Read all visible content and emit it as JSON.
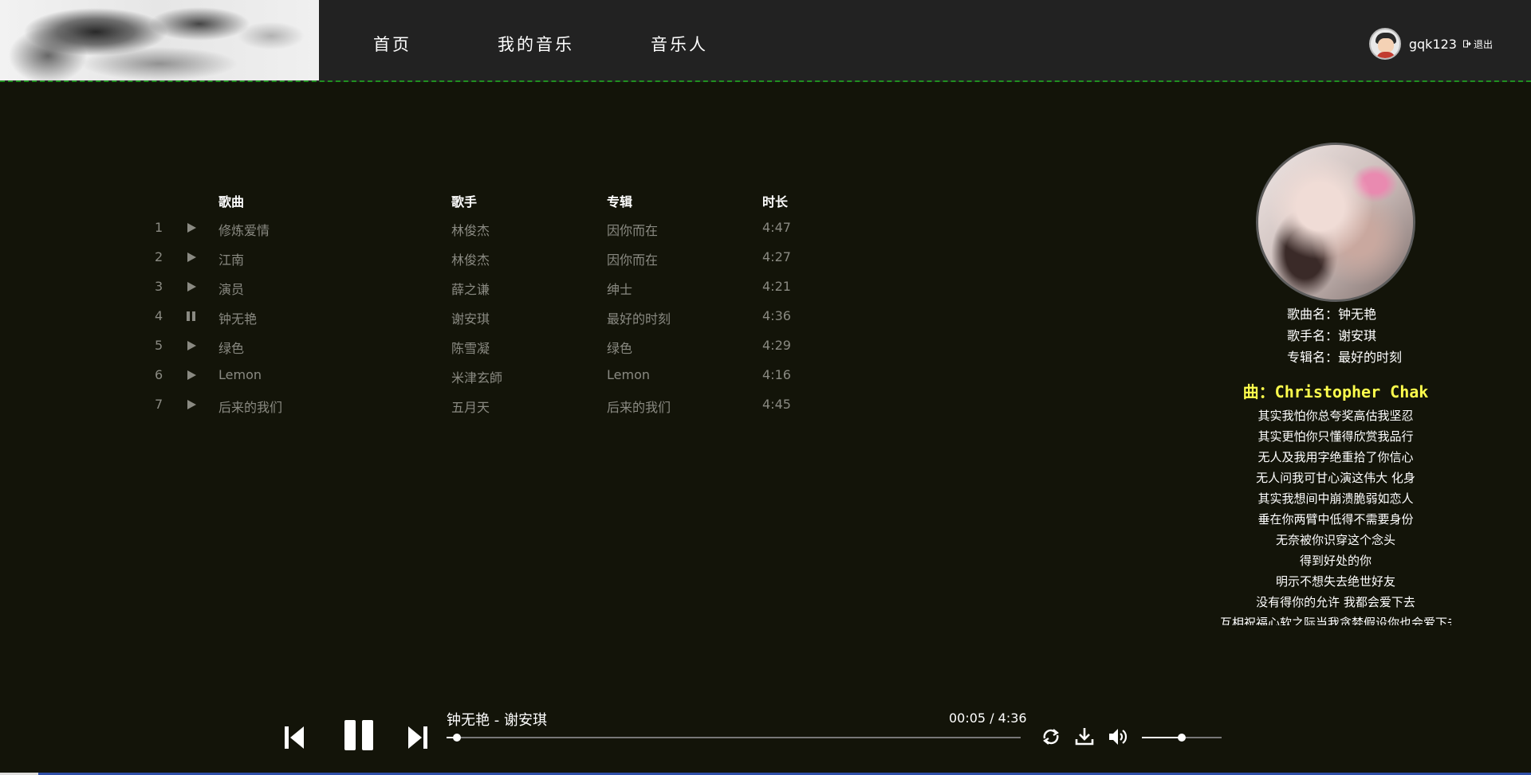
{
  "nav": {
    "items": [
      {
        "label": "首页"
      },
      {
        "label": "我的音乐"
      },
      {
        "label": "音乐人"
      }
    ]
  },
  "user": {
    "name": "gqk123",
    "logout_label": "退出"
  },
  "table": {
    "headers": {
      "song": "歌曲",
      "artist": "歌手",
      "album": "专辑",
      "duration": "时长"
    },
    "rows": [
      {
        "num": "1",
        "title": "修炼爱情",
        "artist": "林俊杰",
        "album": "因你而在",
        "duration": "4:47",
        "state": "play"
      },
      {
        "num": "2",
        "title": "江南",
        "artist": "林俊杰",
        "album": "因你而在",
        "duration": "4:27",
        "state": "play"
      },
      {
        "num": "3",
        "title": "演员",
        "artist": "薛之谦",
        "album": "绅士",
        "duration": "4:21",
        "state": "play"
      },
      {
        "num": "4",
        "title": "钟无艳",
        "artist": "谢安琪",
        "album": "最好的时刻",
        "duration": "4:36",
        "state": "pause"
      },
      {
        "num": "5",
        "title": "绿色",
        "artist": "陈雪凝",
        "album": "绿色",
        "duration": "4:29",
        "state": "play"
      },
      {
        "num": "6",
        "title": "Lemon",
        "artist": "米津玄師",
        "album": "Lemon",
        "duration": "4:16",
        "state": "play"
      },
      {
        "num": "7",
        "title": "后来的我们",
        "artist": "五月天",
        "album": "后来的我们",
        "duration": "4:45",
        "state": "play"
      }
    ]
  },
  "now_playing_info": {
    "song": "歌曲名：钟无艳",
    "artist": "歌手名：谢安琪",
    "album": "专辑名：最好的时刻"
  },
  "lyrics": {
    "title": "曲：Christopher Chak",
    "lines": [
      "其实我怕你总夸奖高估我坚忍",
      "其实更怕你只懂得欣赏我品行",
      "无人及我用字绝重拾了你信心",
      "无人问我可甘心演这伟大 化身",
      "其实我想间中崩溃脆弱如恋人",
      "垂在你两臂中低得不需要身份",
      "无奈被你识穿这个念头",
      "得到好处的你",
      "明示不想失去绝世好友",
      "没有得你的允许 我都会爱下去",
      "互相祝福心软之际当我贪婪假设你也会爱下去"
    ]
  },
  "player": {
    "title": "钟无艳 - 谢安琪",
    "time": "00:05 / 4:36",
    "progress": 0.018,
    "volume": 0.5
  },
  "colors": {
    "background": "#131409",
    "header": "#222222",
    "header_border": "#1f8f1f",
    "lyric_title": "#ffff4d",
    "muted_text": "#8a8a82"
  }
}
